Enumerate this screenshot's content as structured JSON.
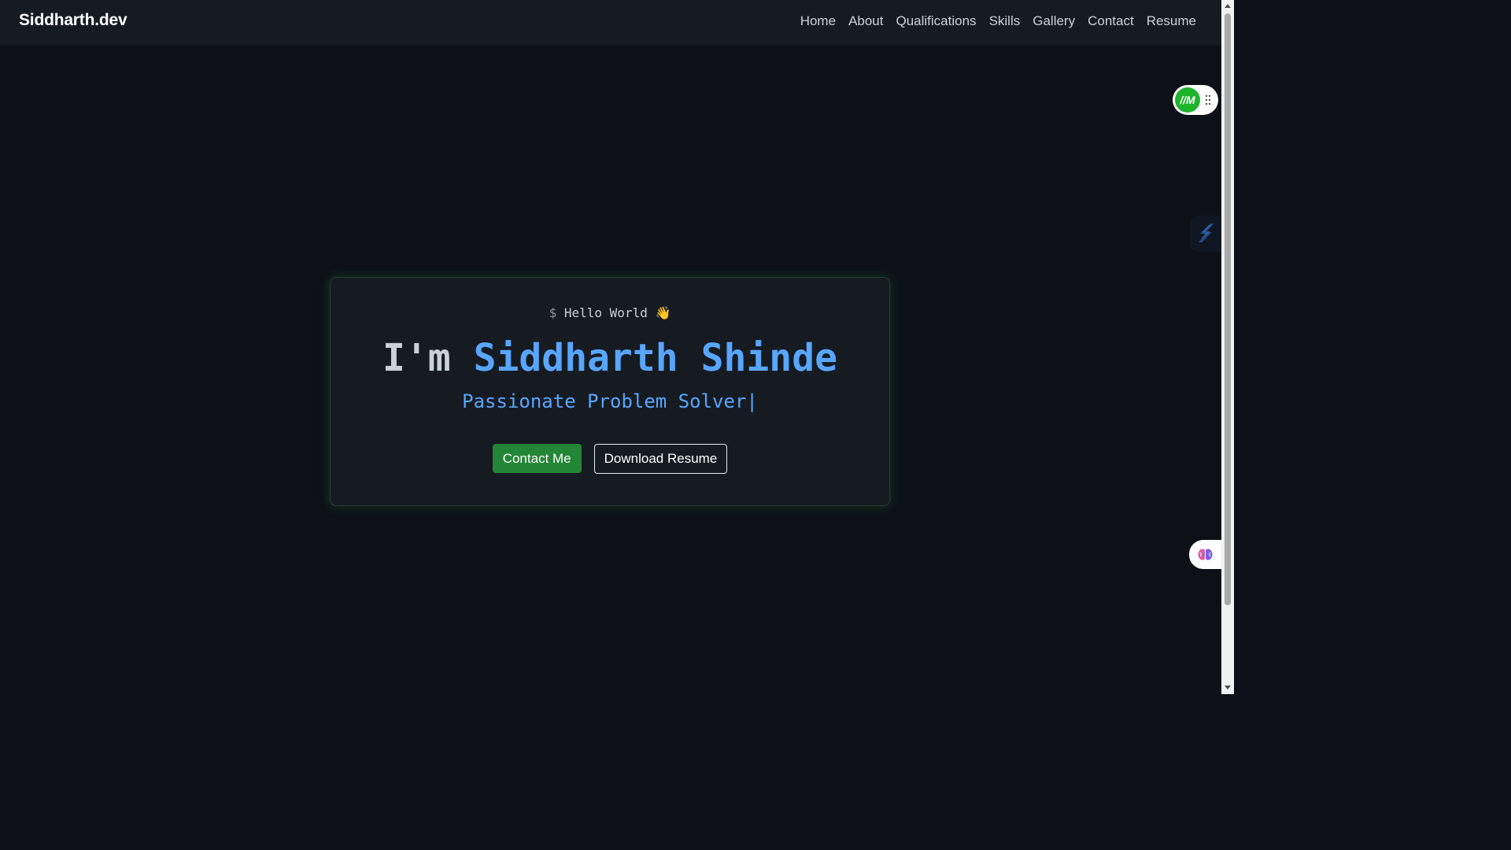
{
  "navbar": {
    "brand": "Siddharth.dev",
    "links": [
      {
        "label": "Home"
      },
      {
        "label": "About"
      },
      {
        "label": "Qualifications"
      },
      {
        "label": "Skills"
      },
      {
        "label": "Gallery"
      },
      {
        "label": "Contact"
      },
      {
        "label": "Resume"
      }
    ]
  },
  "hero": {
    "prompt_symbol": "$",
    "greeting": "Hello World 👋",
    "title_prefix": "I'm",
    "name": "Siddharth Shinde",
    "typed_subtitle": "Passionate Problem Solver|",
    "buttons": {
      "contact_label": "Contact Me",
      "resume_label": "Download Resume"
    }
  },
  "widgets": {
    "toggle_logo_text": "//M",
    "toggle_icon": "grip-dots-icon",
    "side_icon": "lightning-icon",
    "assistant_icon": "brain-icon"
  },
  "colors": {
    "background": "#0d1117",
    "navbar": "#161b22",
    "card": "#161b22",
    "accent_blue": "#58a6ff",
    "accent_green": "#238636",
    "text": "#c9d1d9"
  }
}
